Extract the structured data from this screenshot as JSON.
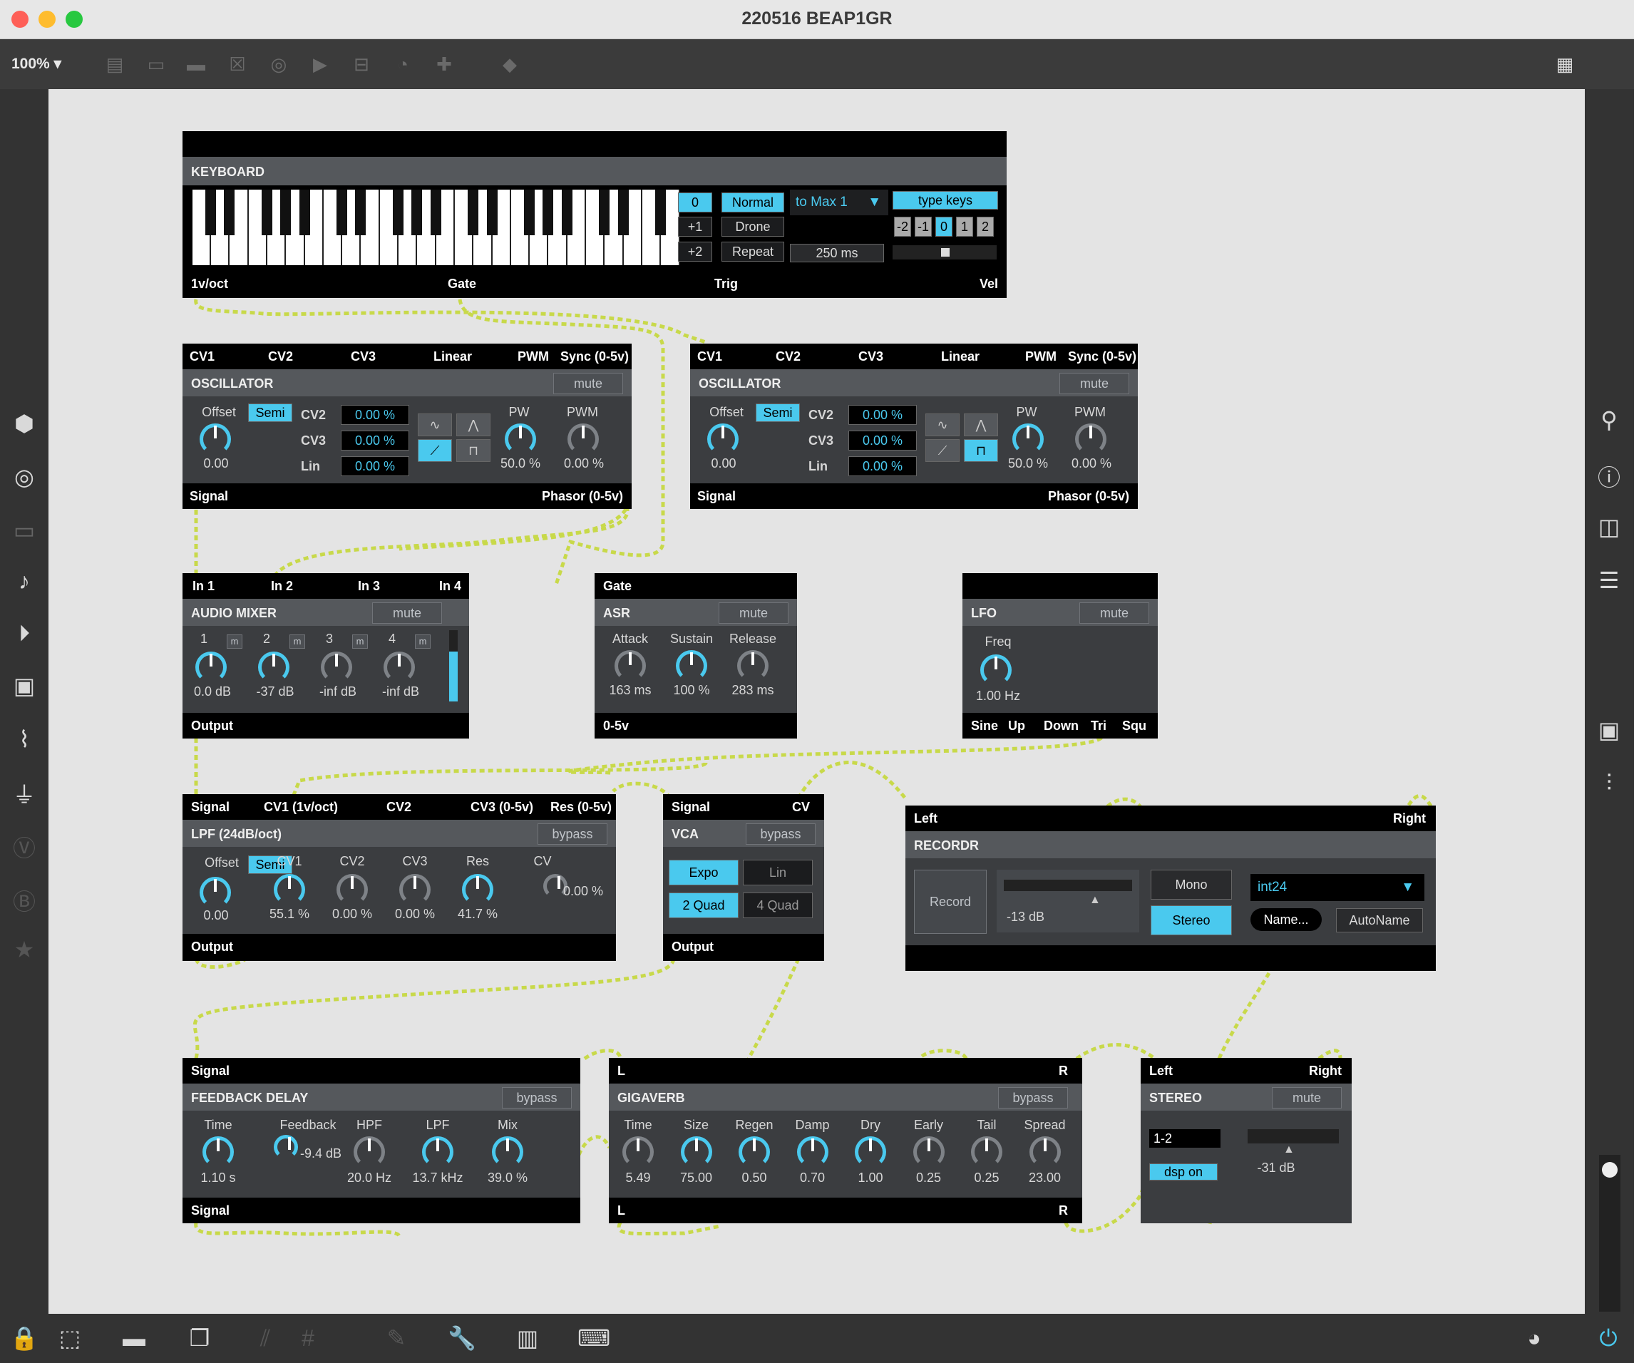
{
  "window": {
    "title": "220516 BEAP1GR",
    "zoom": "100%"
  },
  "colors": {
    "accent": "#4ac9ee",
    "wire": "#c8d94a",
    "panel": "#3b3d40"
  },
  "toolbar": {
    "icons": [
      "presentation-icon",
      "comment-icon",
      "message-icon",
      "toggle-icon",
      "button-icon",
      "play-icon",
      "slider-icon",
      "dial-icon",
      "plus-icon",
      "paint-bucket-icon",
      "grid-icon"
    ]
  },
  "left_sidebar": {
    "icons": [
      "package-icon",
      "target-icon",
      "device-icon",
      "note-icon",
      "media-icon",
      "image-icon",
      "paperclip-icon",
      "plug-icon",
      "v-icon",
      "b-icon",
      "star-icon"
    ]
  },
  "right_sidebar": {
    "icons": [
      "search-icon",
      "info-icon",
      "columns-icon",
      "list-icon",
      "snapshot-icon",
      "mixer-icon",
      "power-icon"
    ]
  },
  "keyboard": {
    "title": "KEYBOARD",
    "outputs": [
      "1v/oct",
      "Gate",
      "Trig",
      "Vel"
    ],
    "oct": [
      "0",
      "+1",
      "+2"
    ],
    "modes": [
      "Normal",
      "Drone",
      "Repeat"
    ],
    "selected_mode": "Normal",
    "route": "to Max 1",
    "time": "250 ms",
    "typekeys": "type keys",
    "octave_shift": [
      "-2",
      "-1",
      "0",
      "1",
      "2"
    ]
  },
  "osc1": {
    "inputs": [
      "CV1",
      "CV2",
      "CV3",
      "Linear",
      "PWM",
      "Sync (0-5v)"
    ],
    "title": "OSCILLATOR",
    "mute": "mute",
    "offset_label": "Offset",
    "semi": "Semi",
    "offset_val": "0.00",
    "cv_labels": [
      "CV2",
      "CV3",
      "Lin"
    ],
    "cv_vals": [
      "0.00 %",
      "0.00 %",
      "0.00 %"
    ],
    "pw_label": "PW",
    "pw_val": "50.0 %",
    "pwm_label": "PWM",
    "pwm_val": "0.00 %",
    "outputs": [
      "Signal",
      "Phasor (0-5v)"
    ]
  },
  "osc2": {
    "inputs": [
      "CV1",
      "CV2",
      "CV3",
      "Linear",
      "PWM",
      "Sync (0-5v)"
    ],
    "title": "OSCILLATOR",
    "mute": "mute",
    "offset_label": "Offset",
    "semi": "Semi",
    "offset_val": "0.00",
    "cv_labels": [
      "CV2",
      "CV3",
      "Lin"
    ],
    "cv_vals": [
      "0.00 %",
      "0.00 %",
      "0.00 %"
    ],
    "pw_label": "PW",
    "pw_val": "50.0 %",
    "pwm_label": "PWM",
    "pwm_val": "0.00 %",
    "outputs": [
      "Signal",
      "Phasor (0-5v)"
    ]
  },
  "mixer": {
    "inputs": [
      "In 1",
      "In 2",
      "In 3",
      "In 4"
    ],
    "title": "AUDIO MIXER",
    "mute": "mute",
    "channels": [
      "1",
      "2",
      "3",
      "4"
    ],
    "m": "m",
    "vals": [
      "0.0 dB",
      "-37 dB",
      "-inf dB",
      "-inf dB"
    ],
    "output": "Output"
  },
  "asr": {
    "input": "Gate",
    "title": "ASR",
    "mute": "mute",
    "labels": [
      "Attack",
      "Sustain",
      "Release"
    ],
    "vals": [
      "163 ms",
      "100 %",
      "283 ms"
    ],
    "output": "0-5v"
  },
  "lfo": {
    "title": "LFO",
    "mute": "mute",
    "freq_label": "Freq",
    "freq_val": "1.00 Hz",
    "outputs": [
      "Sine",
      "Up",
      "Down",
      "Tri",
      "Squ"
    ]
  },
  "lpf": {
    "inputs": [
      "Signal",
      "CV1 (1v/oct)",
      "CV2",
      "CV3 (0-5v)",
      "Res (0-5v)"
    ],
    "title": "LPF (24dB/oct)",
    "bypass": "bypass",
    "offset_label": "Offset",
    "semi": "Semi",
    "offset_val": "0.00",
    "labels": [
      "CV1",
      "CV2",
      "CV3",
      "Res",
      "CV"
    ],
    "vals": [
      "55.1 %",
      "0.00 %",
      "0.00 %",
      "41.7 %",
      "0.00 %"
    ],
    "output": "Output"
  },
  "vca": {
    "inputs": [
      "Signal",
      "CV"
    ],
    "title": "VCA",
    "bypass": "bypass",
    "buttons": [
      "Expo",
      "Lin",
      "2 Quad",
      "4 Quad"
    ],
    "output": "Output"
  },
  "recordr": {
    "inputs": [
      "Left",
      "Right"
    ],
    "title": "RECORDR",
    "record": "Record",
    "level": "-13 dB",
    "mono": "Mono",
    "stereo": "Stereo",
    "format": "int24",
    "name": "Name...",
    "autoname": "AutoName"
  },
  "delay": {
    "input": "Signal",
    "title": "FEEDBACK DELAY",
    "bypass": "bypass",
    "labels": [
      "Time",
      "Feedback",
      "HPF",
      "LPF",
      "Mix"
    ],
    "vals": [
      "1.10 s",
      "-9.4 dB",
      "20.0 Hz",
      "13.7 kHz",
      "39.0 %"
    ],
    "output": "Signal"
  },
  "reverb": {
    "inputs": [
      "L",
      "R"
    ],
    "title": "GIGAVERB",
    "bypass": "bypass",
    "labels": [
      "Time",
      "Size",
      "Regen",
      "Damp",
      "Dry",
      "Early",
      "Tail",
      "Spread"
    ],
    "vals": [
      "5.49",
      "75.00",
      "0.50",
      "0.70",
      "1.00",
      "0.25",
      "0.25",
      "23.00"
    ],
    "outputs": [
      "L",
      "R"
    ]
  },
  "stereo": {
    "inputs": [
      "Left",
      "Right"
    ],
    "title": "STEREO",
    "mute": "mute",
    "channels": "1-2",
    "dsp": "dsp on",
    "level": "-31 dB"
  }
}
